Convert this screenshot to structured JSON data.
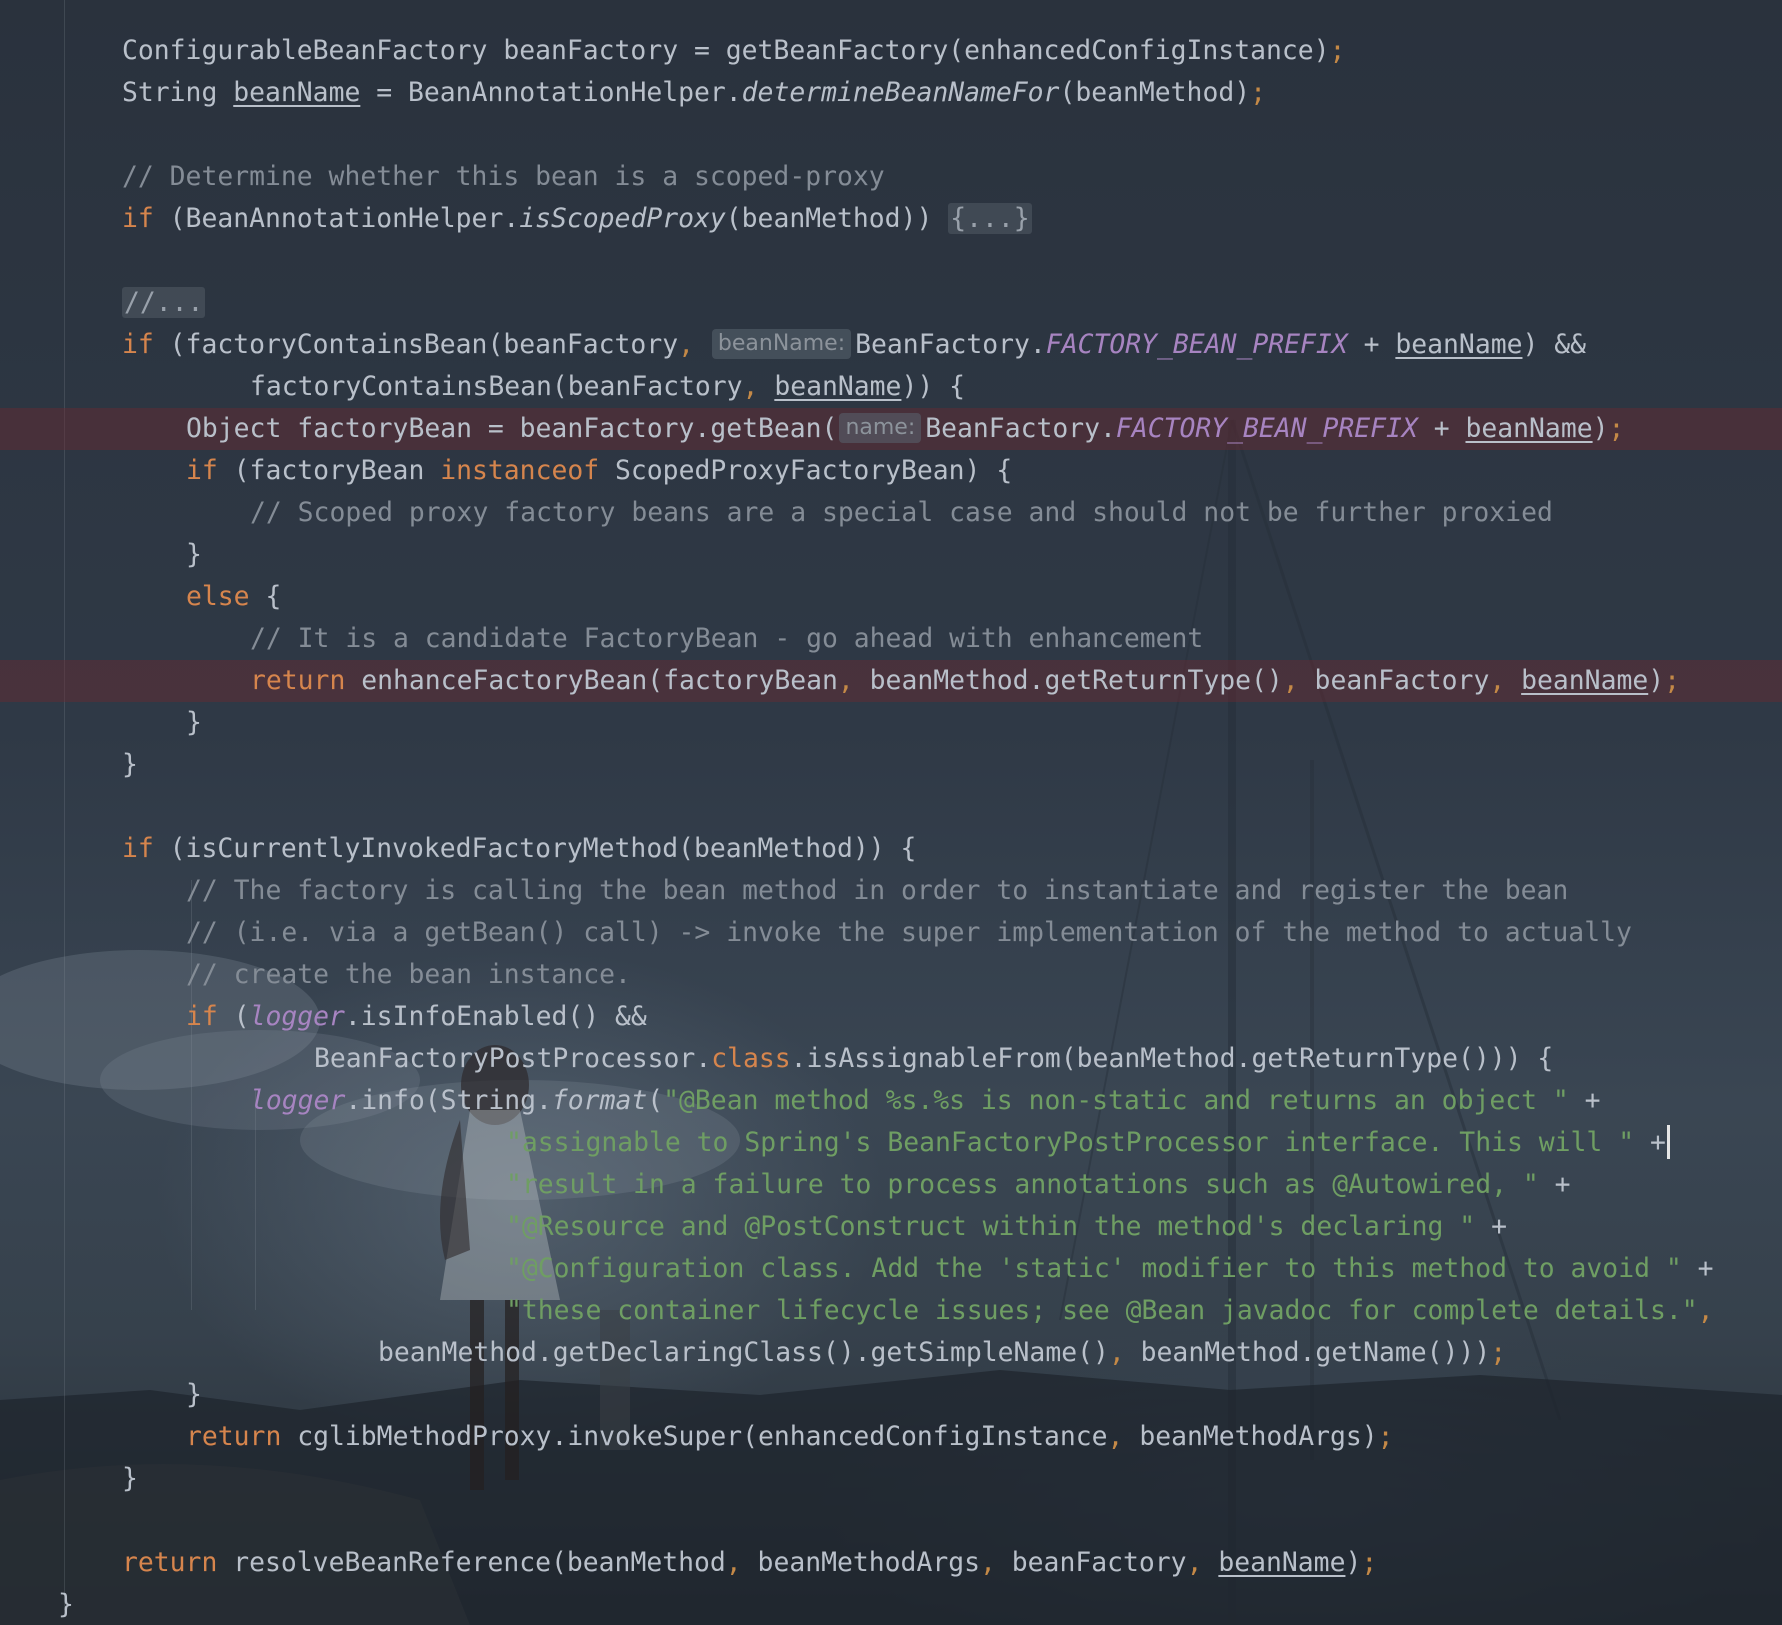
{
  "code_lines": [
    {
      "indent": 1,
      "tokens": [
        {
          "t": "ConfigurableBeanFactory beanFactory = getBeanFactory(enhancedConfigInstance)"
        },
        {
          "t": ";",
          "c": "pn"
        }
      ]
    },
    {
      "indent": 1,
      "tokens": [
        {
          "t": "String "
        },
        {
          "t": "beanName",
          "c": "ul"
        },
        {
          "t": " = BeanAnnotationHelper."
        },
        {
          "t": "determineBeanNameFor",
          "c": "it"
        },
        {
          "t": "(beanMethod)"
        },
        {
          "t": ";",
          "c": "pn"
        }
      ]
    },
    {
      "indent": 0,
      "tokens": []
    },
    {
      "indent": 1,
      "tokens": [
        {
          "t": "// Determine whether this bean is a scoped-proxy",
          "c": "cm"
        }
      ]
    },
    {
      "indent": 1,
      "tokens": [
        {
          "t": "if",
          "c": "kw"
        },
        {
          "t": " (BeanAnnotationHelper."
        },
        {
          "t": "isScopedProxy",
          "c": "it"
        },
        {
          "t": "(beanMethod)) "
        },
        {
          "t": "{...}",
          "c": "fold"
        }
      ]
    },
    {
      "indent": 0,
      "tokens": []
    },
    {
      "indent": 1,
      "tokens": [
        {
          "t": "//...",
          "c": "cm fold"
        }
      ]
    },
    {
      "indent": 1,
      "tokens": [
        {
          "t": "if",
          "c": "kw"
        },
        {
          "t": " (factoryContainsBean(beanFactory"
        },
        {
          "t": ",",
          "c": "pn"
        },
        {
          "t": " "
        },
        {
          "hint": "beanName:"
        },
        {
          "t": "BeanFactory."
        },
        {
          "t": "FACTORY_BEAN_PREFIX",
          "c": "fld"
        },
        {
          "t": " + "
        },
        {
          "t": "beanName",
          "c": "ul"
        },
        {
          "t": ") &&"
        }
      ]
    },
    {
      "indent": 3,
      "tokens": [
        {
          "t": "factoryContainsBean(beanFactory"
        },
        {
          "t": ",",
          "c": "pn"
        },
        {
          "t": " "
        },
        {
          "t": "beanName",
          "c": "ul"
        },
        {
          "t": ")) {"
        }
      ]
    },
    {
      "indent": 2,
      "highlight": true,
      "tokens": [
        {
          "t": "Object factoryBean = beanFactory.getBean("
        },
        {
          "hint": "name:"
        },
        {
          "t": "BeanFactory."
        },
        {
          "t": "FACTORY_BEAN_PREFIX",
          "c": "fld"
        },
        {
          "t": " + "
        },
        {
          "t": "beanName",
          "c": "ul"
        },
        {
          "t": ")"
        },
        {
          "t": ";",
          "c": "pn"
        }
      ]
    },
    {
      "indent": 2,
      "tokens": [
        {
          "t": "if",
          "c": "kw"
        },
        {
          "t": " (factoryBean "
        },
        {
          "t": "instanceof",
          "c": "kw"
        },
        {
          "t": " ScopedProxyFactoryBean) {"
        }
      ]
    },
    {
      "indent": 3,
      "tokens": [
        {
          "t": "// Scoped proxy factory beans are a special case and should not be further proxied",
          "c": "cm"
        }
      ]
    },
    {
      "indent": 2,
      "tokens": [
        {
          "t": "}"
        }
      ]
    },
    {
      "indent": 2,
      "tokens": [
        {
          "t": "else",
          "c": "kw"
        },
        {
          "t": " {"
        }
      ]
    },
    {
      "indent": 3,
      "tokens": [
        {
          "t": "// It is a candidate FactoryBean - go ahead with enhancement",
          "c": "cm"
        }
      ]
    },
    {
      "indent": 3,
      "highlight": true,
      "tokens": [
        {
          "t": "return",
          "c": "kw"
        },
        {
          "t": " enhanceFactoryBean(factoryBean"
        },
        {
          "t": ",",
          "c": "pn"
        },
        {
          "t": " beanMethod.getReturnType()"
        },
        {
          "t": ",",
          "c": "pn"
        },
        {
          "t": " beanFactory"
        },
        {
          "t": ",",
          "c": "pn"
        },
        {
          "t": " "
        },
        {
          "t": "beanName",
          "c": "ul"
        },
        {
          "t": ")"
        },
        {
          "t": ";",
          "c": "pn"
        }
      ]
    },
    {
      "indent": 2,
      "tokens": [
        {
          "t": "}"
        }
      ]
    },
    {
      "indent": 1,
      "tokens": [
        {
          "t": "}"
        }
      ]
    },
    {
      "indent": 0,
      "tokens": []
    },
    {
      "indent": 1,
      "tokens": [
        {
          "t": "if",
          "c": "kw"
        },
        {
          "t": " (isCurrentlyInvokedFactoryMethod(beanMethod)) {"
        }
      ]
    },
    {
      "indent": 2,
      "tokens": [
        {
          "t": "// The factory is calling the bean method in order to instantiate and register the bean",
          "c": "cm"
        }
      ]
    },
    {
      "indent": 2,
      "tokens": [
        {
          "t": "// (i.e. via a getBean() call) -> invoke the super implementation of the method to actually",
          "c": "cm"
        }
      ]
    },
    {
      "indent": 2,
      "tokens": [
        {
          "t": "// create the bean instance.",
          "c": "cm"
        }
      ]
    },
    {
      "indent": 2,
      "tokens": [
        {
          "t": "if",
          "c": "kw"
        },
        {
          "t": " ("
        },
        {
          "t": "logger",
          "c": "fld"
        },
        {
          "t": ".isInfoEnabled() &&"
        }
      ]
    },
    {
      "indent": 4,
      "tokens": [
        {
          "t": "BeanFactoryPostProcessor."
        },
        {
          "t": "class",
          "c": "kw"
        },
        {
          "t": ".isAssignableFrom(beanMethod.getReturnType())) {"
        }
      ]
    },
    {
      "indent": 3,
      "tokens": [
        {
          "t": "logger",
          "c": "fld"
        },
        {
          "t": ".info(String."
        },
        {
          "t": "format",
          "c": "it"
        },
        {
          "t": "("
        },
        {
          "t": "\"@Bean method %s.%s is non-static and returns an object \"",
          "c": "st"
        },
        {
          "t": " +"
        }
      ]
    },
    {
      "indent": 7,
      "caret": true,
      "tokens": [
        {
          "t": "\"assignable to Spring's BeanFactoryPostProcessor interface. This will \"",
          "c": "st"
        },
        {
          "t": " +"
        }
      ]
    },
    {
      "indent": 7,
      "tokens": [
        {
          "t": "\"result in a failure to process annotations such as @Autowired, \"",
          "c": "st"
        },
        {
          "t": " +"
        }
      ]
    },
    {
      "indent": 7,
      "tokens": [
        {
          "t": "\"@Resource and @PostConstruct within the method's declaring \"",
          "c": "st"
        },
        {
          "t": " +"
        }
      ]
    },
    {
      "indent": 7,
      "tokens": [
        {
          "t": "\"@Configuration class. Add the 'static' modifier to this method to avoid \"",
          "c": "st"
        },
        {
          "t": " +"
        }
      ]
    },
    {
      "indent": 7,
      "tokens": [
        {
          "t": "\"these container lifecycle issues; see @Bean javadoc for complete details.\"",
          "c": "st"
        },
        {
          "t": ",",
          "c": "pn"
        }
      ]
    },
    {
      "indent": 5,
      "tokens": [
        {
          "t": "beanMethod.getDeclaringClass().getSimpleName()"
        },
        {
          "t": ",",
          "c": "pn"
        },
        {
          "t": " beanMethod.getName()))"
        },
        {
          "t": ";",
          "c": "pn"
        }
      ]
    },
    {
      "indent": 2,
      "tokens": [
        {
          "t": "}"
        }
      ]
    },
    {
      "indent": 2,
      "tokens": [
        {
          "t": "return",
          "c": "kw"
        },
        {
          "t": " cglibMethodProxy.invokeSuper(enhancedConfigInstance"
        },
        {
          "t": ",",
          "c": "pn"
        },
        {
          "t": " beanMethodArgs)"
        },
        {
          "t": ";",
          "c": "pn"
        }
      ]
    },
    {
      "indent": 1,
      "tokens": [
        {
          "t": "}"
        }
      ]
    },
    {
      "indent": 0,
      "tokens": []
    },
    {
      "indent": 1,
      "tokens": [
        {
          "t": "return",
          "c": "kw"
        },
        {
          "t": " resolveBeanReference(beanMethod"
        },
        {
          "t": ",",
          "c": "pn"
        },
        {
          "t": " beanMethodArgs"
        },
        {
          "t": ",",
          "c": "pn"
        },
        {
          "t": " beanFactory"
        },
        {
          "t": ",",
          "c": "pn"
        },
        {
          "t": " "
        },
        {
          "t": "beanName",
          "c": "ul"
        },
        {
          "t": ")"
        },
        {
          "t": ";",
          "c": "pn"
        }
      ]
    },
    {
      "indent": 0,
      "tokens": [
        {
          "t": "}"
        }
      ]
    }
  ],
  "colors": {
    "keyword": "#d6854d",
    "comment": "#848c96",
    "string": "#6f9e63",
    "field": "#a784c1",
    "text": "#b9c0ca",
    "breakpoint_row": "#6e2830"
  }
}
